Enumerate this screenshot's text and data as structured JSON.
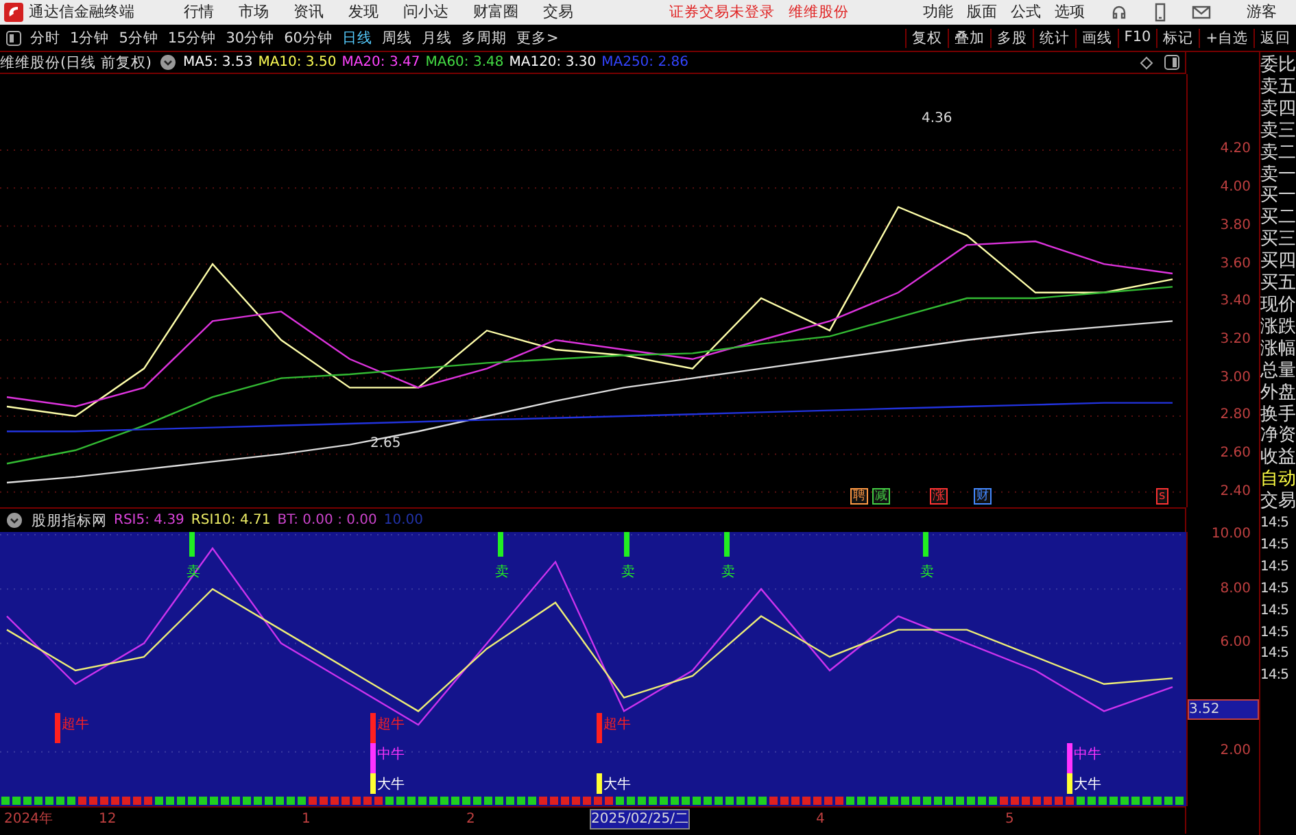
{
  "title_bar": {
    "app_name": "通达信金融终端",
    "menus": [
      "行情",
      "市场",
      "资讯",
      "发现",
      "问小达",
      "财富圈",
      "交易"
    ],
    "notices": [
      "证券交易未登录",
      "维维股份"
    ],
    "tools": [
      "功能",
      "版面",
      "公式",
      "选项"
    ],
    "user": "游客"
  },
  "toolbar": {
    "periods": [
      {
        "label": "分时",
        "selected": false
      },
      {
        "label": "1分钟",
        "selected": false
      },
      {
        "label": "5分钟",
        "selected": false
      },
      {
        "label": "15分钟",
        "selected": false
      },
      {
        "label": "30分钟",
        "selected": false
      },
      {
        "label": "60分钟",
        "selected": false
      },
      {
        "label": "日线",
        "selected": true
      },
      {
        "label": "周线",
        "selected": false
      },
      {
        "label": "月线",
        "selected": false
      },
      {
        "label": "多周期",
        "selected": false
      },
      {
        "label": "更多>",
        "selected": false
      }
    ],
    "actions": [
      "复权",
      "叠加",
      "多股",
      "统计",
      "画线",
      "F10",
      "标记",
      "+自选",
      "返回"
    ]
  },
  "price_panel": {
    "title": "维维股份(日线 前复权)",
    "legend": [
      {
        "text": "MA5: 3.53",
        "color": "#ffffff"
      },
      {
        "text": "MA10: 3.50",
        "color": "#ffff55"
      },
      {
        "text": "MA20: 3.47",
        "color": "#ff44ff"
      },
      {
        "text": "MA60: 3.48",
        "color": "#44dd44"
      },
      {
        "text": "MA120: 3.30",
        "color": "#ffffff"
      },
      {
        "text": "MA250: 2.86",
        "color": "#3344ff"
      }
    ],
    "extreme_labels": [
      "4.36",
      "2.65"
    ],
    "events": [
      {
        "text": "聘",
        "color": "#ff9944"
      },
      {
        "text": "减",
        "color": "#44cc44"
      },
      {
        "text": "涨",
        "color": "#ff3333"
      },
      {
        "text": "财",
        "color": "#4488ff"
      },
      {
        "text": "s",
        "color": "#ff3333"
      }
    ],
    "chart_data": {
      "type": "line",
      "grid": true,
      "ylim": [
        2.32,
        4.6
      ],
      "yticks": [
        {
          "value": 2.4,
          "label": "2.40"
        },
        {
          "value": 2.6,
          "label": "2.60"
        },
        {
          "value": 2.8,
          "label": "2.80"
        },
        {
          "value": 3.0,
          "label": "3.00"
        },
        {
          "value": 3.2,
          "label": "3.20"
        },
        {
          "value": 3.4,
          "label": "3.40"
        },
        {
          "value": 3.6,
          "label": "3.60"
        },
        {
          "value": 3.8,
          "label": "3.80"
        },
        {
          "value": 4.0,
          "label": "4.00"
        },
        {
          "value": 4.2,
          "label": "4.20"
        }
      ],
      "series": [
        {
          "color": "#ffffaa",
          "values": [
            2.85,
            2.8,
            3.05,
            3.6,
            3.2,
            2.95,
            2.95,
            3.25,
            3.15,
            3.12,
            3.05,
            3.42,
            3.25,
            3.9,
            3.75,
            3.45,
            3.45,
            3.52
          ]
        },
        {
          "color": "#dd33dd",
          "values": [
            2.9,
            2.85,
            2.95,
            3.3,
            3.35,
            3.1,
            2.95,
            3.05,
            3.2,
            3.15,
            3.1,
            3.2,
            3.3,
            3.45,
            3.7,
            3.72,
            3.6,
            3.55
          ]
        },
        {
          "color": "#33bb33",
          "values": [
            2.55,
            2.62,
            2.75,
            2.9,
            3.0,
            3.02,
            3.05,
            3.08,
            3.1,
            3.12,
            3.13,
            3.18,
            3.22,
            3.32,
            3.42,
            3.42,
            3.45,
            3.48
          ]
        },
        {
          "color": "#dddddd",
          "values": [
            2.45,
            2.48,
            2.52,
            2.56,
            2.6,
            2.65,
            2.72,
            2.8,
            2.88,
            2.95,
            3.0,
            3.05,
            3.1,
            3.15,
            3.2,
            3.24,
            3.27,
            3.3
          ]
        },
        {
          "color": "#2233dd",
          "values": [
            2.72,
            2.72,
            2.73,
            2.74,
            2.75,
            2.76,
            2.77,
            2.78,
            2.79,
            2.8,
            2.81,
            2.82,
            2.83,
            2.84,
            2.85,
            2.86,
            2.87,
            2.87
          ]
        }
      ]
    }
  },
  "indicator_panel": {
    "title": "股朋指标网",
    "legend": [
      {
        "text": "RSI5: 4.39",
        "color": "#dd44dd"
      },
      {
        "text": "RSI10: 4.71",
        "color": "#eeee66"
      },
      {
        "text": "BT: 0.00 : 0.00",
        "color": "#cc44cc"
      },
      {
        "text": "10.00",
        "color": "#2233aa"
      }
    ],
    "cursor_value": "3.52",
    "signals": [
      {
        "text": "卖",
        "kind": "sell"
      },
      {
        "text": "卖",
        "kind": "sell"
      },
      {
        "text": "卖",
        "kind": "sell"
      },
      {
        "text": "卖",
        "kind": "sell"
      },
      {
        "text": "卖",
        "kind": "sell"
      },
      {
        "text": "超牛",
        "kind": "super_bull"
      },
      {
        "text": "超牛",
        "kind": "super_bull"
      },
      {
        "text": "中牛",
        "kind": "mid_bull"
      },
      {
        "text": "大牛",
        "kind": "big_bull"
      },
      {
        "text": "超牛",
        "kind": "super_bull"
      },
      {
        "text": "大牛",
        "kind": "big_bull"
      },
      {
        "text": "中牛",
        "kind": "mid_bull"
      },
      {
        "text": "大牛",
        "kind": "big_bull"
      }
    ],
    "x_axis_labels": [
      {
        "label": "2024年",
        "selected": false
      },
      {
        "label": "12",
        "selected": false
      },
      {
        "label": "1",
        "selected": false
      },
      {
        "label": "2",
        "selected": false
      },
      {
        "label": "2025/02/25/二",
        "selected": true
      },
      {
        "label": "4",
        "selected": false
      },
      {
        "label": "5",
        "selected": false
      }
    ],
    "chart_data": {
      "type": "line",
      "grid": true,
      "ylim": [
        0,
        10.1
      ],
      "yticks": [
        {
          "value": 2,
          "label": "2.00"
        },
        {
          "value": 6,
          "label": "6.00"
        },
        {
          "value": 8,
          "label": "8.00"
        },
        {
          "value": 10,
          "label": "10.00"
        }
      ],
      "series": [
        {
          "color": "#cc33ee",
          "values": [
            7,
            4.5,
            6,
            9.5,
            6,
            4.5,
            3,
            6,
            9,
            3.5,
            5,
            8,
            5,
            7,
            6,
            5,
            3.5,
            4.39
          ]
        },
        {
          "color": "#eeee77",
          "values": [
            6.5,
            5,
            5.5,
            8,
            6.5,
            5,
            3.5,
            5.8,
            7.5,
            4,
            4.8,
            7,
            5.5,
            6.5,
            6.5,
            5.5,
            4.5,
            4.71
          ]
        }
      ]
    }
  },
  "quote_panel": {
    "rows": [
      {
        "text": "委比",
        "kind": "label"
      },
      {
        "text": "卖五",
        "kind": "label"
      },
      {
        "text": "卖四",
        "kind": "label"
      },
      {
        "text": "卖三",
        "kind": "label"
      },
      {
        "text": "卖二",
        "kind": "label"
      },
      {
        "text": "卖一",
        "kind": "label"
      },
      {
        "text": "买一",
        "kind": "label"
      },
      {
        "text": "买二",
        "kind": "label"
      },
      {
        "text": "买三",
        "kind": "label"
      },
      {
        "text": "买四",
        "kind": "label"
      },
      {
        "text": "买五",
        "kind": "label"
      },
      {
        "text": "现价",
        "kind": "label"
      },
      {
        "text": "涨跌",
        "kind": "label"
      },
      {
        "text": "涨幅",
        "kind": "label"
      },
      {
        "text": "总量",
        "kind": "label"
      },
      {
        "text": "外盘",
        "kind": "label"
      },
      {
        "text": "换手",
        "kind": "label"
      },
      {
        "text": "净资",
        "kind": "label"
      },
      {
        "text": "收益",
        "kind": "label"
      },
      {
        "text": "自动",
        "kind": "accent"
      },
      {
        "text": "交易",
        "kind": "label"
      },
      {
        "text": "14:5",
        "kind": "time"
      },
      {
        "text": "14:5",
        "kind": "time"
      },
      {
        "text": "14:5",
        "kind": "time"
      },
      {
        "text": "14:5",
        "kind": "time"
      },
      {
        "text": "14:5",
        "kind": "time"
      },
      {
        "text": "14:5",
        "kind": "time"
      },
      {
        "text": "14:5",
        "kind": "time"
      },
      {
        "text": "14:5",
        "kind": "time"
      }
    ]
  }
}
